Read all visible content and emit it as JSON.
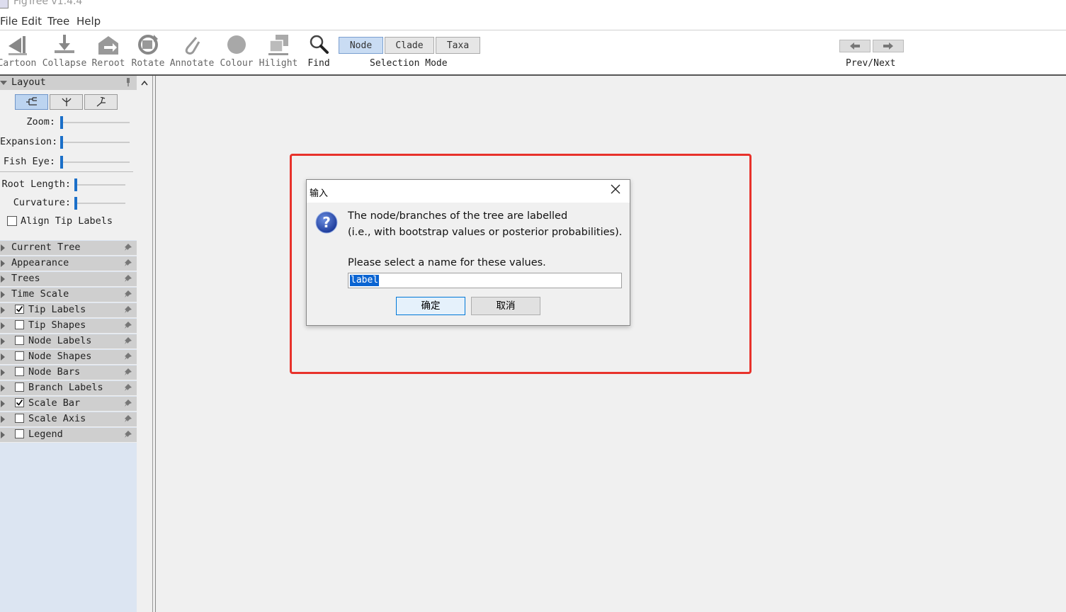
{
  "window": {
    "title": "FigTree v1.4.4"
  },
  "menu": [
    "File",
    "Edit",
    "Tree",
    "Help"
  ],
  "toolbar": {
    "tools": [
      "Cartoon",
      "Collapse",
      "Reroot",
      "Rotate",
      "Annotate",
      "Colour",
      "Hilight",
      "Find"
    ],
    "selection_modes": [
      "Node",
      "Clade",
      "Taxa"
    ],
    "selected_mode": "Node",
    "selection_label": "Selection Mode",
    "prev_next_label": "Prev/Next"
  },
  "sidebar": {
    "layout": {
      "title": "Layout",
      "zoom_label": "Zoom:",
      "expansion_label": "Expansion:",
      "fisheye_label": "Fish Eye:",
      "root_length_label": "Root Length:",
      "curvature_label": "Curvature:",
      "align_tip_label": "Align Tip Labels",
      "align_tip_checked": false
    },
    "panels": [
      {
        "label": "Current Tree",
        "checkbox": false,
        "checked": false
      },
      {
        "label": "Appearance",
        "checkbox": false,
        "checked": false
      },
      {
        "label": "Trees",
        "checkbox": false,
        "checked": false
      },
      {
        "label": "Time Scale",
        "checkbox": false,
        "checked": false
      },
      {
        "label": "Tip Labels",
        "checkbox": true,
        "checked": true
      },
      {
        "label": "Tip Shapes",
        "checkbox": true,
        "checked": false
      },
      {
        "label": "Node Labels",
        "checkbox": true,
        "checked": false
      },
      {
        "label": "Node Shapes",
        "checkbox": true,
        "checked": false
      },
      {
        "label": "Node Bars",
        "checkbox": true,
        "checked": false
      },
      {
        "label": "Branch Labels",
        "checkbox": true,
        "checked": false
      },
      {
        "label": "Scale Bar",
        "checkbox": true,
        "checked": true
      },
      {
        "label": "Scale Axis",
        "checkbox": true,
        "checked": false
      },
      {
        "label": "Legend",
        "checkbox": true,
        "checked": false
      }
    ]
  },
  "dialog": {
    "title": "输入",
    "line1": "The node/branches of the tree are labelled",
    "line2": "(i.e., with bootstrap values or posterior probabilities).",
    "line3": "Please select a name for these values.",
    "input_value": "label",
    "ok_label": "确定",
    "cancel_label": "取消"
  },
  "colors": {
    "accent": "#1b6fc8",
    "highlight_box": "#e8322b",
    "selection": "#0a64d2"
  }
}
